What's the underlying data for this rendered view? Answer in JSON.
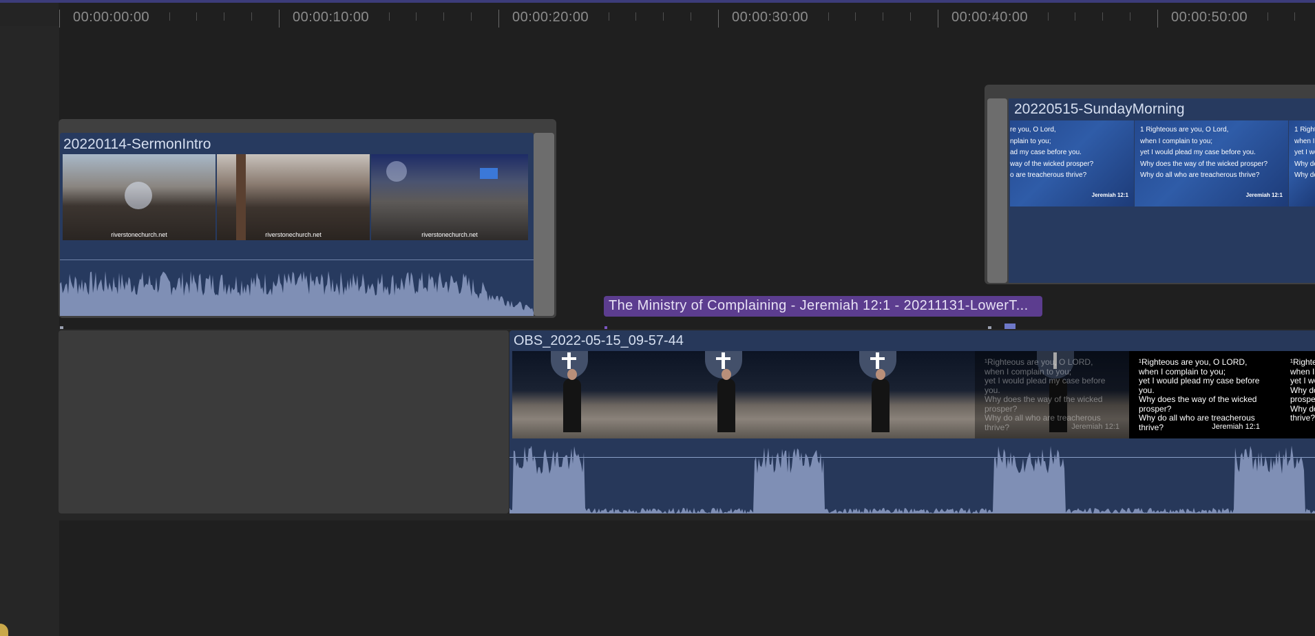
{
  "ruler": {
    "timecodes": [
      "00:00:00:00",
      "00:00:10:00",
      "00:00:20:00",
      "00:00:30:00",
      "00:00:40:00",
      "00:00:50:00"
    ]
  },
  "clips": {
    "sermon_intro": {
      "title": "20220114-SermonIntro",
      "thumb_watermark": "riverstonechurch.net"
    },
    "sunday_morning": {
      "title": "20220515-SundayMorning",
      "slide_lines_partial": [
        "re you, O Lord,",
        "nplain to you;",
        "ad my case before you.",
        "way of the wicked prosper?",
        "o are treacherous thrive?"
      ],
      "slide_lines": [
        "1 Righteous are you, O Lord,",
        "when I complain to you;",
        "yet I would plead my case before you.",
        "Why does the way of the wicked prosper?",
        "Why do all who are treacherous thrive?"
      ],
      "slide_lines_cut": [
        "1 Righteous a",
        "when I compl",
        "yet I would p",
        "Why does th",
        "Why do all w"
      ],
      "slide_ref": "Jeremiah 12:1"
    },
    "title_clip": {
      "title": "The Ministry of Complaining - Jeremiah 12:1 - 20211131-LowerT..."
    },
    "obs": {
      "title": "OBS_2022-05-15_09-57-44",
      "overlay_lines": [
        "¹Righteous are you, O LORD,",
        "when I complain to you;",
        "yet I would plead my case before you.",
        "Why does the way of the wicked",
        "prosper?",
        "Why do all who are treacherous",
        "thrive?"
      ],
      "slide_lines": [
        "¹Righteous are you, O LORD,",
        "when I complain to you;",
        "yet I would plead my case before you.",
        "Why does the way of the wicked",
        "prosper?",
        "Why do all who are treacherous",
        "thrive?"
      ],
      "slide_lines_cut": [
        "¹Righteous",
        "when I com",
        "yet I would",
        "Why does t",
        "prosper?",
        "Why do all",
        "thrive?"
      ],
      "slide_ref": "Jeremiah 12:1"
    }
  },
  "colors": {
    "background": "#1f1f1f",
    "clip_blue": "#27385a",
    "waveform": "#7f8fb5",
    "title_purple": "#5c3d8f",
    "playhead": "#6e78c8",
    "empty_clip": "#3b3b3b"
  }
}
